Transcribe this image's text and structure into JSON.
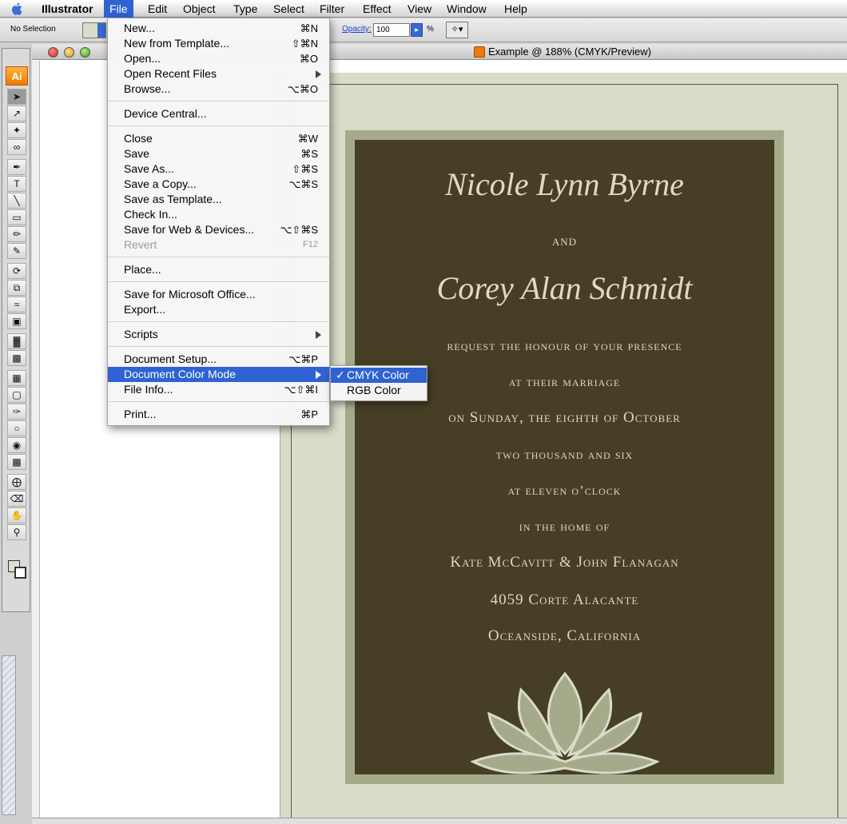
{
  "menubar": {
    "app_name": "Illustrator",
    "items": [
      "File",
      "Edit",
      "Object",
      "Type",
      "Select",
      "Filter",
      "Effect",
      "View",
      "Window",
      "Help"
    ],
    "active": "File"
  },
  "controlbar": {
    "selection": "No Selection",
    "opacity_label": "Opacity:",
    "opacity_value": "100",
    "percent": "%"
  },
  "toolbar": {
    "logo": "Ai"
  },
  "document": {
    "title": "Example @ 188% (CMYK/Preview)"
  },
  "file_menu": {
    "items": [
      {
        "label": "New...",
        "shortcut": "⌘N"
      },
      {
        "label": "New from Template...",
        "shortcut": "⇧⌘N"
      },
      {
        "label": "Open...",
        "shortcut": "⌘O"
      },
      {
        "label": "Open Recent Files",
        "submenu": true
      },
      {
        "label": "Browse...",
        "shortcut": "⌥⌘O"
      },
      {
        "label": "Device Central..."
      },
      {
        "label": "Close",
        "shortcut": "⌘W"
      },
      {
        "label": "Save",
        "shortcut": "⌘S"
      },
      {
        "label": "Save As...",
        "shortcut": "⇧⌘S"
      },
      {
        "label": "Save a Copy...",
        "shortcut": "⌥⌘S"
      },
      {
        "label": "Save as Template..."
      },
      {
        "label": "Check In..."
      },
      {
        "label": "Save for Web & Devices...",
        "shortcut": "⌥⇧⌘S"
      },
      {
        "label": "Revert",
        "shortcut": "F12",
        "disabled": true
      },
      {
        "label": "Place..."
      },
      {
        "label": "Save for Microsoft Office..."
      },
      {
        "label": "Export..."
      },
      {
        "label": "Scripts",
        "submenu": true
      },
      {
        "label": "Document Setup...",
        "shortcut": "⌥⌘P"
      },
      {
        "label": "Document Color Mode",
        "submenu": true,
        "highlighted": true
      },
      {
        "label": "File Info...",
        "shortcut": "⌥⇧⌘I"
      },
      {
        "label": "Print...",
        "shortcut": "⌘P"
      }
    ]
  },
  "color_mode_submenu": {
    "items": [
      {
        "label": "CMYK Color",
        "checked": true,
        "check": "✓"
      },
      {
        "label": "RGB Color",
        "checked": false
      }
    ]
  },
  "invitation": {
    "bride": "Nicole Lynn Byrne",
    "and": "and",
    "groom": "Corey Alan Schmidt",
    "line1": "request the honour of your presence",
    "line2": "at their marriage",
    "line3": "on Sunday, the eighth of October",
    "line4": "two thousand and six",
    "line5": "at eleven o’clock",
    "line6": "in the home of",
    "hosts": "Kate McCavitt & John Flanagan",
    "address1": "4059 Corte Alacante",
    "address2": "Oceanside, California"
  },
  "colors": {
    "accent": "#2e63d1",
    "card_bg": "#463f25",
    "card_border": "#a5aa8a",
    "artboard": "#d8dcc8"
  }
}
